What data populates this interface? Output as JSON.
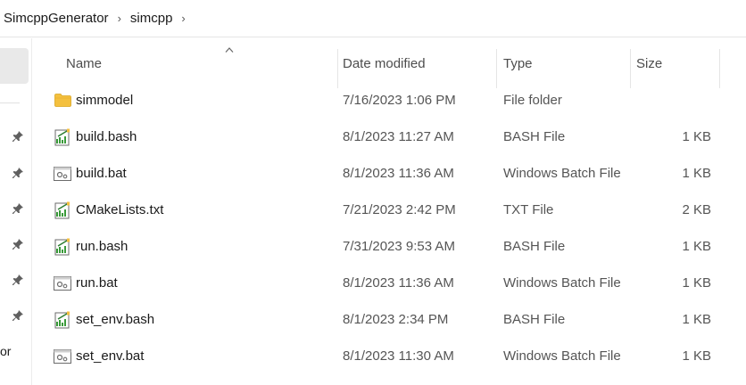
{
  "breadcrumb": {
    "items": [
      "SimcppGenerator",
      "simcpp"
    ]
  },
  "nav": {
    "truncated_label": "or"
  },
  "columns": {
    "name": "Name",
    "date": "Date modified",
    "type": "Type",
    "size": "Size"
  },
  "files": [
    {
      "name": "simmodel",
      "date": "7/16/2023 1:06 PM",
      "type": "File folder",
      "size": "",
      "icon": "folder-icon"
    },
    {
      "name": "build.bash",
      "date": "8/1/2023 11:27 AM",
      "type": "BASH File",
      "size": "1 KB",
      "icon": "text-file-icon"
    },
    {
      "name": "build.bat",
      "date": "8/1/2023 11:36 AM",
      "type": "Windows Batch File",
      "size": "1 KB",
      "icon": "batch-file-icon"
    },
    {
      "name": "CMakeLists.txt",
      "date": "7/21/2023 2:42 PM",
      "type": "TXT File",
      "size": "2 KB",
      "icon": "text-file-icon"
    },
    {
      "name": "run.bash",
      "date": "7/31/2023 9:53 AM",
      "type": "BASH File",
      "size": "1 KB",
      "icon": "text-file-icon"
    },
    {
      "name": "run.bat",
      "date": "8/1/2023 11:36 AM",
      "type": "Windows Batch File",
      "size": "1 KB",
      "icon": "batch-file-icon"
    },
    {
      "name": "set_env.bash",
      "date": "8/1/2023 2:34 PM",
      "type": "BASH File",
      "size": "1 KB",
      "icon": "text-file-icon"
    },
    {
      "name": "set_env.bat",
      "date": "8/1/2023 11:30 AM",
      "type": "Windows Batch File",
      "size": "1 KB",
      "icon": "batch-file-icon"
    }
  ],
  "colors": {
    "folder": "#f4c03e",
    "text_file_accent": "#3a9a3a",
    "pin": "#5f5f5f"
  }
}
